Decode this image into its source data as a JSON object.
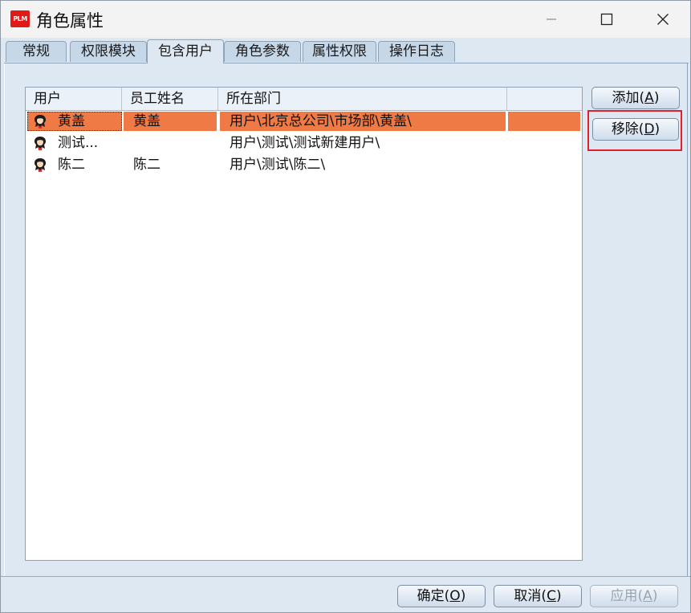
{
  "window": {
    "title": "角色属性",
    "icon_text": "PLM",
    "controls": [
      "minimize-icon",
      "maximize-icon",
      "close-icon"
    ]
  },
  "tabs": [
    {
      "label": "常规",
      "active": false
    },
    {
      "label": "权限模块",
      "active": false
    },
    {
      "label": "包含用户",
      "active": true
    },
    {
      "label": "角色参数",
      "active": false
    },
    {
      "label": "属性权限",
      "active": false
    },
    {
      "label": "操作日志",
      "active": false
    }
  ],
  "table": {
    "columns": [
      "用户",
      "员工姓名",
      "所在部门",
      ""
    ],
    "rows": [
      {
        "user": "黄盖",
        "employee_name": "黄盖",
        "department": "用户\\北京总公司\\市场部\\黄盖\\",
        "selected": true
      },
      {
        "user": "测试...",
        "employee_name": "",
        "department": "用户\\测试\\测试新建用户\\",
        "selected": false
      },
      {
        "user": "陈二",
        "employee_name": "陈二",
        "department": "用户\\测试\\陈二\\",
        "selected": false
      }
    ]
  },
  "side_buttons": {
    "add_label": "添加(",
    "add_key": "A",
    "add_end": ")",
    "remove_label": "移除(",
    "remove_key": "D",
    "remove_end": ")"
  },
  "footer_buttons": {
    "ok_label": "确定(",
    "ok_key": "O",
    "ok_end": ")",
    "cancel_label": "取消(",
    "cancel_key": "C",
    "cancel_end": ")",
    "apply_label": "应用(",
    "apply_key": "A",
    "apply_end": ")"
  },
  "colors": {
    "selection": "#f07a45",
    "highlight_border": "#e0202a",
    "window_bg": "#dde8f3"
  }
}
